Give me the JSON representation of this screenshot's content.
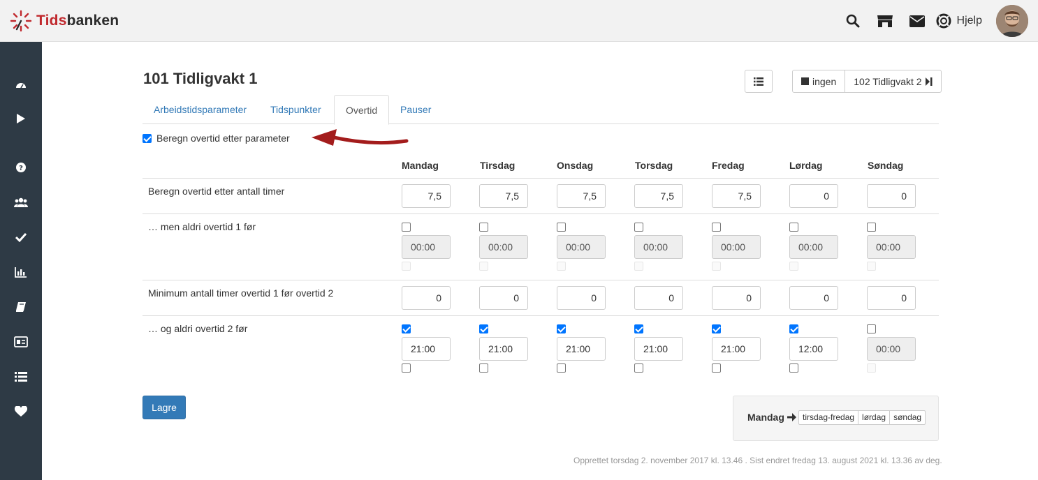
{
  "app": {
    "logo_prefix": "Tids",
    "logo_suffix": "banken",
    "help_label": "Hjelp"
  },
  "page": {
    "title": "101 Tidligvakt 1",
    "nav_none_label": "ingen",
    "nav_next_label": "102 Tidligvakt 2"
  },
  "tabs": [
    {
      "label": "Arbeidstidsparameter",
      "active": false
    },
    {
      "label": "Tidspunkter",
      "active": false
    },
    {
      "label": "Overtid",
      "active": true
    },
    {
      "label": "Pauser",
      "active": false
    }
  ],
  "overtime": {
    "param_checkbox_label": "Beregn overtid etter parameter",
    "param_checked": true,
    "days": [
      "Mandag",
      "Tirsdag",
      "Onsdag",
      "Torsdag",
      "Fredag",
      "Lørdag",
      "Søndag"
    ],
    "rows": {
      "hours": {
        "label": "Beregn overtid etter antall timer",
        "values": [
          "7,5",
          "7,5",
          "7,5",
          "7,5",
          "7,5",
          "0",
          "0"
        ]
      },
      "never_ot1_before": {
        "label": "… men aldri overtid 1 før",
        "checked": [
          false,
          false,
          false,
          false,
          false,
          false,
          false
        ],
        "values": [
          "00:00",
          "00:00",
          "00:00",
          "00:00",
          "00:00",
          "00:00",
          "00:00"
        ]
      },
      "min_hours_ot1": {
        "label": "Minimum antall timer overtid 1 før overtid 2",
        "values": [
          "0",
          "0",
          "0",
          "0",
          "0",
          "0",
          "0"
        ]
      },
      "never_ot2_before": {
        "label": "… og aldri overtid 2 før",
        "checked": [
          true,
          true,
          true,
          true,
          true,
          true,
          false
        ],
        "values": [
          "21:00",
          "21:00",
          "21:00",
          "21:00",
          "21:00",
          "12:00",
          "00:00"
        ]
      }
    }
  },
  "actions": {
    "save_label": "Lagre"
  },
  "copy": {
    "label": "Mandag",
    "buttons": [
      "tirsdag-fredag",
      "lørdag",
      "søndag"
    ]
  },
  "footer": {
    "note": "Opprettet torsdag 2. november 2017 kl. 13.46 . Sist endret fredag 13. august 2021 kl. 13.36 av deg."
  },
  "colors": {
    "sidebar": "#2e3a45",
    "accent": "#337ab7",
    "logo_red": "#c0282d",
    "annotation_arrow": "#a31c1c"
  }
}
